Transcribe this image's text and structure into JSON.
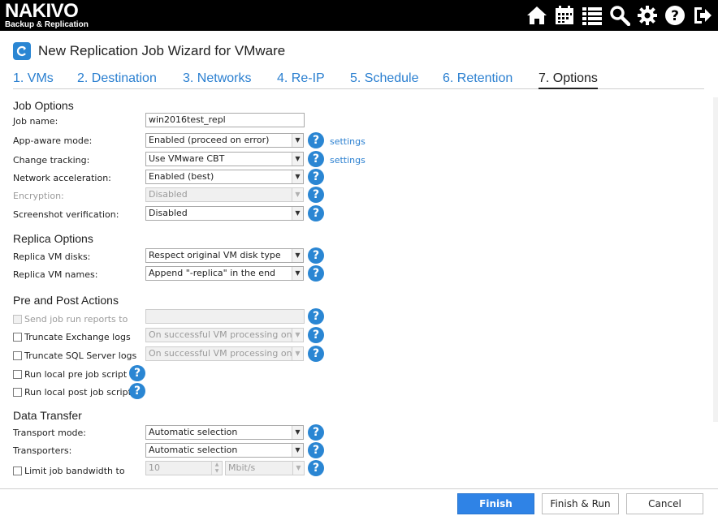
{
  "brand": {
    "name": "NAKIVO",
    "subtitle": "Backup & Replication"
  },
  "header_icons": [
    "home-icon",
    "calendar-icon",
    "list-icon",
    "search-icon",
    "gear-icon",
    "help-icon",
    "logout-icon"
  ],
  "wizard": {
    "title": "New Replication Job Wizard for VMware"
  },
  "tabs": [
    {
      "label": "1. VMs",
      "active": false
    },
    {
      "label": "2. Destination",
      "active": false
    },
    {
      "label": "3. Networks",
      "active": false
    },
    {
      "label": "4. Re-IP",
      "active": false
    },
    {
      "label": "5. Schedule",
      "active": false
    },
    {
      "label": "6. Retention",
      "active": false
    },
    {
      "label": "7. Options",
      "active": true
    }
  ],
  "job_options": {
    "title": "Job Options",
    "job_name_label": "Job name:",
    "job_name_value": "win2016test_repl",
    "app_aware_label": "App-aware mode:",
    "app_aware_value": "Enabled (proceed on error)",
    "app_aware_link": "settings",
    "change_tracking_label": "Change tracking:",
    "change_tracking_value": "Use VMware CBT",
    "change_tracking_link": "settings",
    "network_accel_label": "Network acceleration:",
    "network_accel_value": "Enabled (best)",
    "encryption_label": "Encryption:",
    "encryption_value": "Disabled",
    "screenshot_label": "Screenshot verification:",
    "screenshot_value": "Disabled"
  },
  "replica_options": {
    "title": "Replica Options",
    "disks_label": "Replica VM disks:",
    "disks_value": "Respect original VM disk type",
    "names_label": "Replica VM names:",
    "names_value": "Append \"-replica\" in the end"
  },
  "pre_post": {
    "title": "Pre and Post Actions",
    "send_reports_label": "Send job run reports to",
    "send_reports_value": "",
    "truncate_exchange_label": "Truncate Exchange logs",
    "truncate_exchange_value": "On successful VM processing only",
    "truncate_sql_label": "Truncate SQL Server logs",
    "truncate_sql_value": "On successful VM processing only",
    "pre_script_label": "Run local pre job script",
    "post_script_label": "Run local post job script"
  },
  "data_transfer": {
    "title": "Data Transfer",
    "transport_mode_label": "Transport mode:",
    "transport_mode_value": "Automatic selection",
    "transporters_label": "Transporters:",
    "transporters_value": "Automatic selection",
    "bandwidth_label": "Limit job bandwidth to",
    "bandwidth_value": "10",
    "bandwidth_unit": "Mbit/s"
  },
  "buttons": {
    "finish": "Finish",
    "finish_run": "Finish & Run",
    "cancel": "Cancel"
  },
  "help_glyph": "?",
  "colors": {
    "accent": "#2a86d3",
    "primary_button": "#2f83e6",
    "header_bg": "#000000",
    "link": "#2a7fd0"
  }
}
